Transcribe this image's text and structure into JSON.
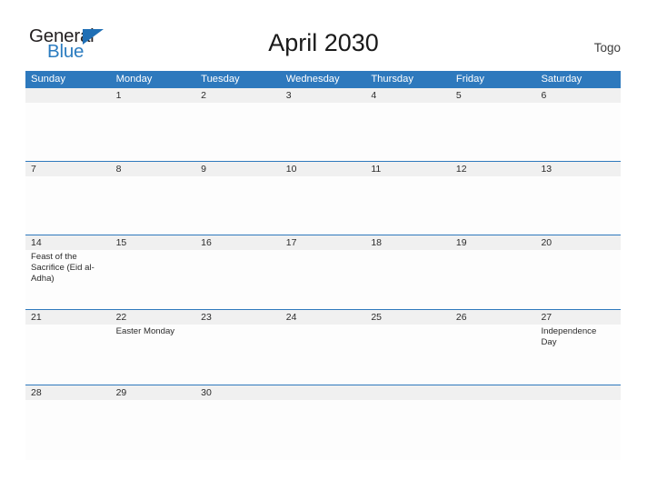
{
  "brand": {
    "word_one": "General",
    "word_two": "Blue",
    "flag_icon": "triangle-flag-icon",
    "accent_color": "#2b7cc0",
    "dark_color": "#231f20"
  },
  "header": {
    "title": "April 2030",
    "country": "Togo"
  },
  "calendar": {
    "header_bg": "#2e79bd",
    "number_band_bg": "#f0f0f0",
    "separator_color": "#2e79bd",
    "day_names": [
      "Sunday",
      "Monday",
      "Tuesday",
      "Wednesday",
      "Thursday",
      "Friday",
      "Saturday"
    ],
    "weeks": [
      {
        "days": [
          {
            "number": "",
            "event": ""
          },
          {
            "number": "1",
            "event": ""
          },
          {
            "number": "2",
            "event": ""
          },
          {
            "number": "3",
            "event": ""
          },
          {
            "number": "4",
            "event": ""
          },
          {
            "number": "5",
            "event": ""
          },
          {
            "number": "6",
            "event": ""
          }
        ]
      },
      {
        "days": [
          {
            "number": "7",
            "event": ""
          },
          {
            "number": "8",
            "event": ""
          },
          {
            "number": "9",
            "event": ""
          },
          {
            "number": "10",
            "event": ""
          },
          {
            "number": "11",
            "event": ""
          },
          {
            "number": "12",
            "event": ""
          },
          {
            "number": "13",
            "event": ""
          }
        ]
      },
      {
        "days": [
          {
            "number": "14",
            "event": "Feast of the Sacrifice (Eid al-Adha)"
          },
          {
            "number": "15",
            "event": ""
          },
          {
            "number": "16",
            "event": ""
          },
          {
            "number": "17",
            "event": ""
          },
          {
            "number": "18",
            "event": ""
          },
          {
            "number": "19",
            "event": ""
          },
          {
            "number": "20",
            "event": ""
          }
        ]
      },
      {
        "days": [
          {
            "number": "21",
            "event": ""
          },
          {
            "number": "22",
            "event": "Easter Monday"
          },
          {
            "number": "23",
            "event": ""
          },
          {
            "number": "24",
            "event": ""
          },
          {
            "number": "25",
            "event": ""
          },
          {
            "number": "26",
            "event": ""
          },
          {
            "number": "27",
            "event": "Independence Day"
          }
        ]
      },
      {
        "days": [
          {
            "number": "28",
            "event": ""
          },
          {
            "number": "29",
            "event": ""
          },
          {
            "number": "30",
            "event": ""
          },
          {
            "number": "",
            "event": ""
          },
          {
            "number": "",
            "event": ""
          },
          {
            "number": "",
            "event": ""
          },
          {
            "number": "",
            "event": ""
          }
        ]
      }
    ]
  }
}
